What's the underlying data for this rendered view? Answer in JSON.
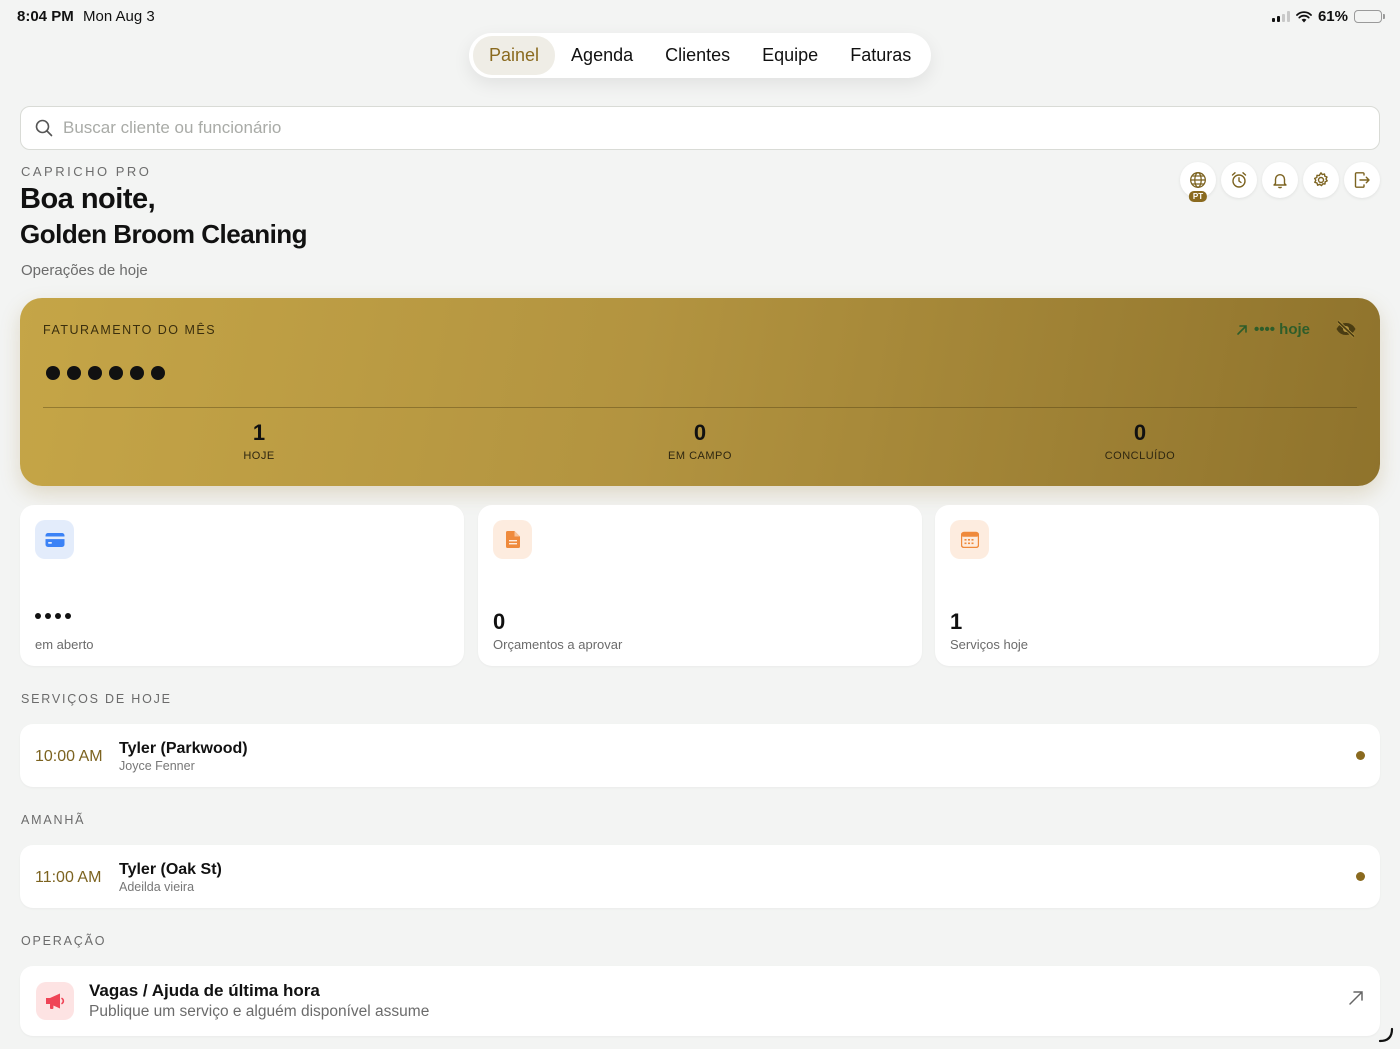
{
  "status": {
    "time": "8:04 PM",
    "date": "Mon Aug 3",
    "battery": "61%",
    "battery_level": 0.61
  },
  "tabs": [
    {
      "label": "Painel",
      "active": true
    },
    {
      "label": "Agenda",
      "active": false
    },
    {
      "label": "Clientes",
      "active": false
    },
    {
      "label": "Equipe",
      "active": false
    },
    {
      "label": "Faturas",
      "active": false
    }
  ],
  "search": {
    "placeholder": "Buscar cliente ou funcionário",
    "value": ""
  },
  "header": {
    "brand": "CAPRICHO PRO",
    "greeting": "Boa noite,",
    "company": "Golden Broom Cleaning",
    "subtitle": "Operações de hoje",
    "language_badge": "PT",
    "icons": [
      "globe-icon",
      "alarm-icon",
      "bell-icon",
      "gear-icon",
      "logout-icon"
    ]
  },
  "revenue": {
    "label": "FATURAMENTO DO MÊS",
    "today_label": "•••• hoje",
    "stats": [
      {
        "value": "1",
        "label": "HOJE"
      },
      {
        "value": "0",
        "label": "EM CAMPO"
      },
      {
        "value": "0",
        "label": "CONCLUÍDO"
      }
    ]
  },
  "cards": [
    {
      "value": "",
      "masked": true,
      "label": "em aberto",
      "icon": "credit-card-icon",
      "color": "#3b82f6",
      "bg": "#e3ecfb"
    },
    {
      "value": "0",
      "masked": false,
      "label": "Orçamentos a aprovar",
      "icon": "document-icon",
      "color": "#ef8a3c",
      "bg": "#fdecdf"
    },
    {
      "value": "1",
      "masked": false,
      "label": "Serviços hoje",
      "icon": "calendar-icon",
      "color": "#ef8a3c",
      "bg": "#fdecdf"
    }
  ],
  "today": {
    "title": "SERVIÇOS DE HOJE",
    "items": [
      {
        "time": "10:00 AM",
        "title": "Tyler (Parkwood)",
        "subtitle": "Joyce Fenner"
      }
    ]
  },
  "tomorrow": {
    "title": "AMANHÃ",
    "items": [
      {
        "time": "11:00 AM",
        "title": "Tyler (Oak St)",
        "subtitle": "Adeilda vieira"
      }
    ]
  },
  "operation": {
    "title": "OPERAÇÃO",
    "item": {
      "title": "Vagas / Ajuda de última hora",
      "subtitle": "Publique um serviço e alguém disponível assume",
      "icon": "megaphone-icon"
    }
  },
  "colors": {
    "accent": "#8a6a1f",
    "background": "#f3f4f3"
  }
}
